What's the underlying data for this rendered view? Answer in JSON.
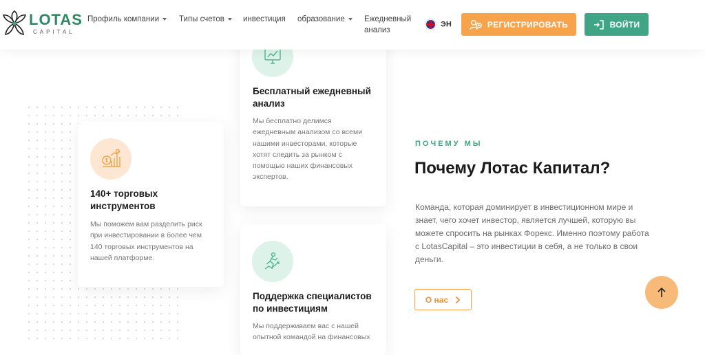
{
  "header": {
    "logo": {
      "name": "LOTAS",
      "sub": "CAPITAL"
    },
    "nav": [
      {
        "label": "Профиль компании",
        "has_dropdown": true
      },
      {
        "label": "Типы счетов",
        "has_dropdown": true
      },
      {
        "label": "инвестиция",
        "has_dropdown": false
      },
      {
        "label": "образование",
        "has_dropdown": true
      },
      {
        "label_line1": "Ежедневный",
        "label_line2": "анализ",
        "has_dropdown": false
      }
    ],
    "language": {
      "label": "ЭН",
      "icon": "uk-flag-icon"
    },
    "register_label": "РЕГИСТРИРОВАТЬ",
    "login_label": "ВОЙТИ"
  },
  "cards": [
    {
      "icon": "analysis-chart-icon",
      "title_line1": "Бесплатный ежедневный",
      "title_line2": "анализ",
      "text": [
        "Мы бесплатно делимся",
        "ежедневным анализом со всеми",
        "нашими инвесторами, которые",
        "хотят следить за рынком с",
        "помощью наших финансовых",
        "экспертов."
      ]
    },
    {
      "icon": "trading-instruments-icon",
      "title_line1": "140+ торговых",
      "title_line2": "инструментов",
      "text": [
        "Мы поможем вам разделить риск",
        "при инвестировании в более чем",
        "140 торговых инструментов на",
        "нашей платформе."
      ]
    },
    {
      "icon": "specialist-support-icon",
      "title_line1": "Поддержка специалистов",
      "title_line2": "по инвестициям",
      "text": [
        "Мы поддерживаем вас с нашей",
        "опытной командой на финансовых"
      ]
    }
  ],
  "why_us": {
    "eyebrow": "ПОЧЕМУ МЫ",
    "headline": "Почему Лотас Капитал?",
    "paragraph": "Команда, которая доминирует в инвестиционном мире и знает, чего хочет инвестор, является лучшей, которую вы можете спросить на рынках Форекс. Именно поэтому работа с LotasCapital – это инвестиции в себя, а не только в свои деньги.",
    "button_label": "О нас"
  },
  "scroll_top": {
    "icon": "arrow-up-icon"
  },
  "colors": {
    "brand_green": "#3fa584",
    "accent_orange": "#f7a34b",
    "scroll_button": "#f7ba79"
  }
}
